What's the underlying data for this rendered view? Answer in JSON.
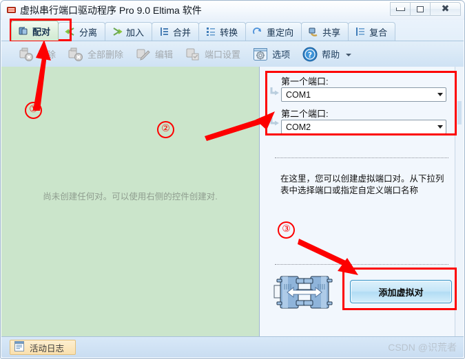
{
  "window": {
    "title": "虚拟串行端口驱动程序 Pro 9.0 Eltima 软件",
    "app_icon": "serial-port-icon",
    "buttons": {
      "minimize": "minimize-icon",
      "maximize": "maximize-icon",
      "close": "close-icon"
    }
  },
  "ribbon": {
    "tabs": [
      {
        "label": "配对",
        "icon": "pair-icon",
        "active": true
      },
      {
        "label": "分离",
        "icon": "split-icon",
        "active": false
      },
      {
        "label": "加入",
        "icon": "join-icon",
        "active": false
      },
      {
        "label": "合并",
        "icon": "merge-icon",
        "active": false
      },
      {
        "label": "转换",
        "icon": "convert-icon",
        "active": false
      },
      {
        "label": "重定向",
        "icon": "redirect-icon",
        "active": false
      },
      {
        "label": "共享",
        "icon": "share-icon",
        "active": false
      },
      {
        "label": "复合",
        "icon": "bundle-icon",
        "active": false
      }
    ],
    "tools": [
      {
        "label": "删除",
        "icon": "delete-port-icon",
        "disabled": true
      },
      {
        "label": "全部删除",
        "icon": "delete-all-ports-icon",
        "disabled": true
      },
      {
        "label": "编辑",
        "icon": "edit-port-icon",
        "disabled": true
      },
      {
        "label": "端口设置",
        "icon": "port-settings-icon",
        "disabled": true
      },
      {
        "label": "选项",
        "icon": "gear-icon",
        "disabled": false
      },
      {
        "label": "帮助",
        "icon": "help-question-icon",
        "disabled": false,
        "caret": true
      }
    ]
  },
  "left_pane": {
    "empty_message": "尚未创建任何对。可以使用右侧的控件创建对."
  },
  "right_pane": {
    "first_port_label": "第一个端口:",
    "first_port_value": "COM1",
    "second_port_label": "第二个端口:",
    "second_port_value": "COM2",
    "description": "在这里，您可以创建虚拟端口对。从下拉列表中选择端口或指定自定义端口名称",
    "connector_icon": "serial-pair-connector-icon",
    "add_button_label": "添加虚拟对"
  },
  "status_bar": {
    "log_label": "活动日志",
    "log_icon": "log-document-icon",
    "watermark": "CSDN @识荒者"
  },
  "annotations": {
    "markers": [
      {
        "id": "1",
        "text": "①"
      },
      {
        "id": "2",
        "text": "②"
      },
      {
        "id": "3",
        "text": "③"
      }
    ],
    "color": "#fd0000"
  }
}
